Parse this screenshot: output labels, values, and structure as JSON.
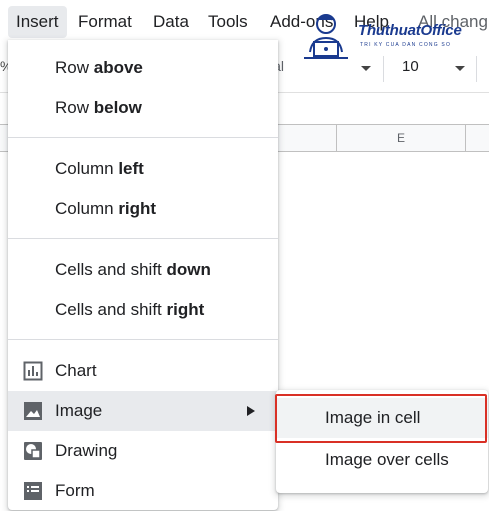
{
  "menubar": {
    "items": [
      {
        "label": "Insert",
        "active": true
      },
      {
        "label": "Format"
      },
      {
        "label": "Data"
      },
      {
        "label": "Tools"
      },
      {
        "label": "Add-ons"
      },
      {
        "label": "Help"
      }
    ],
    "last_edit": "All chang"
  },
  "toolbar": {
    "zoom_fragment": "%",
    "font_fragment": "ial",
    "font_size": "10"
  },
  "grid": {
    "visible_column": "E"
  },
  "insert_menu": {
    "items": [
      {
        "prefix": "Row ",
        "bold": "above"
      },
      {
        "prefix": "Row ",
        "bold": "below"
      },
      {
        "prefix": "Column ",
        "bold": "left"
      },
      {
        "prefix": "Column ",
        "bold": "right"
      },
      {
        "prefix": "Cells and shift ",
        "bold": "down"
      },
      {
        "prefix": "Cells and shift ",
        "bold": "right"
      },
      {
        "label": "Chart",
        "icon": "chart-icon"
      },
      {
        "label": "Image",
        "icon": "image-icon",
        "has_submenu": true
      },
      {
        "label": "Drawing",
        "icon": "drawing-icon"
      },
      {
        "label": "Form",
        "icon": "form-icon"
      }
    ]
  },
  "image_submenu": {
    "items": [
      {
        "label": "Image in cell",
        "highlighted": true
      },
      {
        "label": "Image over cells"
      }
    ]
  },
  "watermark": {
    "brand": "ThuthuatOffice",
    "tagline": "TRI KY CUA DAN CONG SO"
  },
  "colors": {
    "highlight": "#e8eaed",
    "annotation_red": "#d93025",
    "brand_blue": "#1a3a8f"
  }
}
